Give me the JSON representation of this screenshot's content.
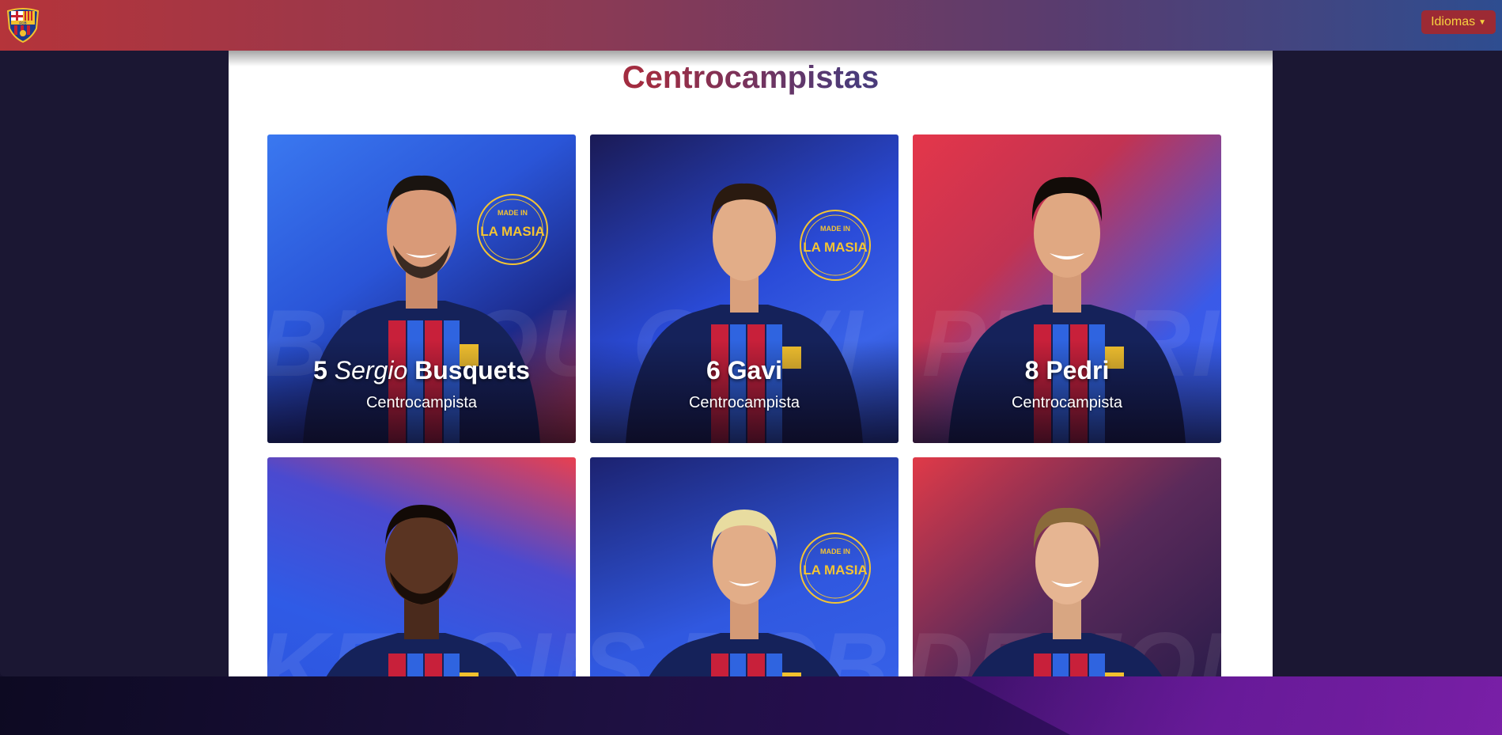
{
  "navbar": {
    "logo_text": "FCB",
    "language_button": "Idiomas"
  },
  "section": {
    "title": "Centrocampistas"
  },
  "players": [
    {
      "number": "5",
      "first_name": "Sergio",
      "last_name": "Busquets",
      "position": "Centrocampista",
      "watermark": "BUSQUETS",
      "badge": "LA MASIA",
      "badge_top": "MADE IN"
    },
    {
      "number": "6",
      "first_name": "",
      "last_name": "Gavi",
      "position": "Centrocampista",
      "watermark": "GAVI",
      "badge": "LA MASIA",
      "badge_top": "MADE IN"
    },
    {
      "number": "8",
      "first_name": "",
      "last_name": "Pedri",
      "position": "Centrocampista",
      "watermark": "PEDRI",
      "badge": "",
      "badge_top": ""
    },
    {
      "number": "",
      "first_name": "",
      "last_name": "",
      "position": "",
      "watermark": "KESSIÉ",
      "badge": "",
      "badge_top": ""
    },
    {
      "number": "",
      "first_name": "",
      "last_name": "",
      "position": "",
      "watermark": "S.ROBERTO",
      "badge": "LA MASIA",
      "badge_top": "MADE IN"
    },
    {
      "number": "",
      "first_name": "",
      "last_name": "",
      "position": "",
      "watermark": "DE JONG",
      "badge": "",
      "badge_top": ""
    }
  ],
  "colors": {
    "nav_red": "#b5343a",
    "nav_blue": "#2e4d90",
    "button_text": "#f6d23f",
    "badge_gold": "#f3c433"
  }
}
